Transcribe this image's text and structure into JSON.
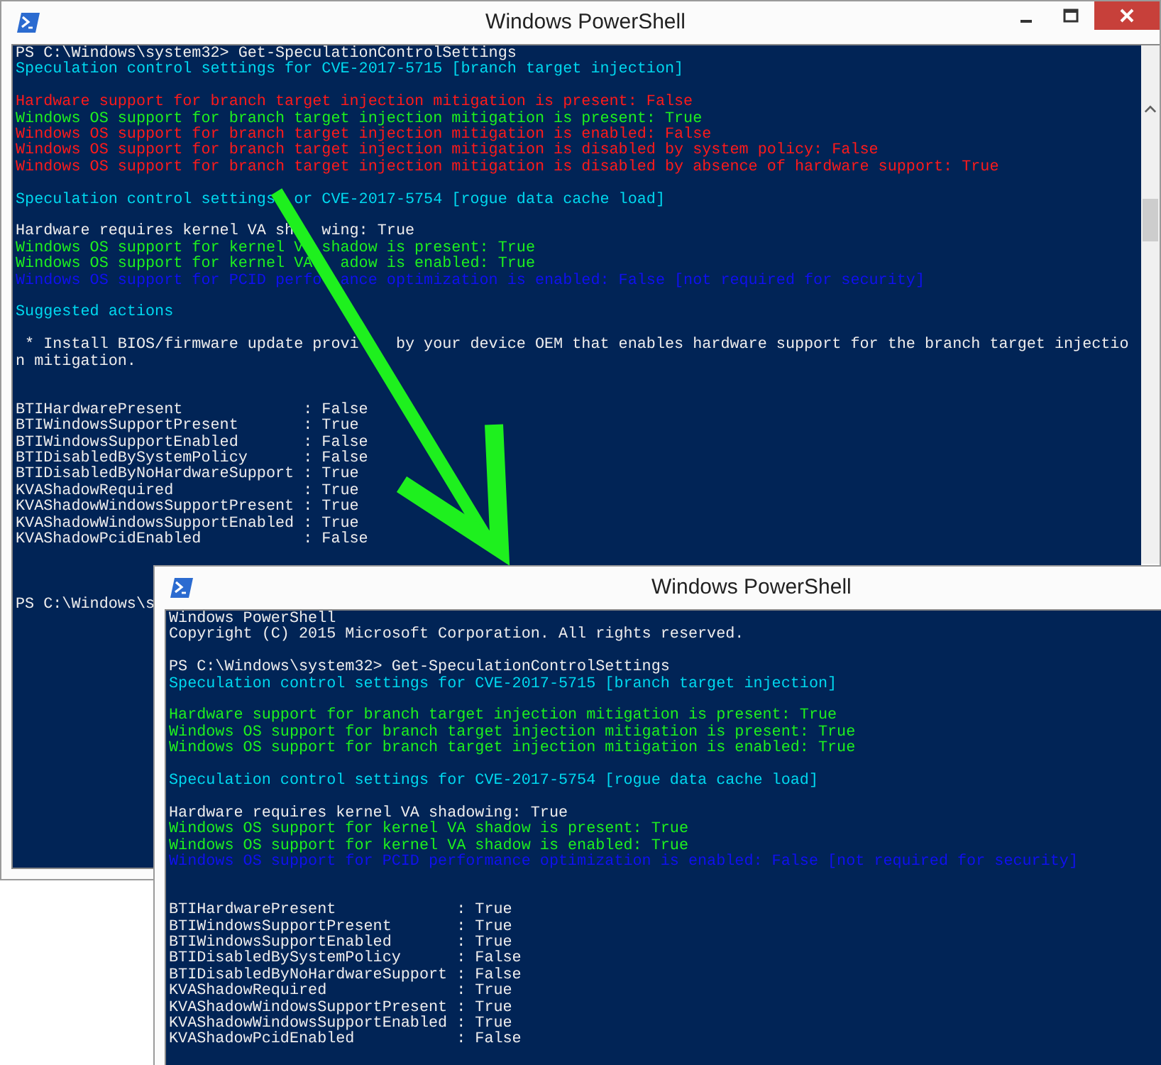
{
  "windows": [
    {
      "title": "Windows PowerShell",
      "controls": true,
      "scrollbar": true,
      "blocks": [
        {
          "kind": "text",
          "lines": [
            {
              "text": "PS C:\\Windows\\system32> Get-SpeculationControlSettings",
              "kind": "plain"
            },
            {
              "text": "Speculation control settings for CVE-2017-5715 [branch target injection]",
              "kind": "heading"
            }
          ]
        },
        {
          "kind": "text",
          "lines": [
            {
              "text": "Hardware support for branch target injection mitigation is present: False",
              "kind": "bad"
            },
            {
              "text": "Windows OS support for branch target injection mitigation is present: True",
              "kind": "good"
            },
            {
              "text": "Windows OS support for branch target injection mitigation is enabled: False",
              "kind": "bad"
            },
            {
              "text": "Windows OS support for branch target injection mitigation is disabled by system policy: False",
              "kind": "bad"
            },
            {
              "text": "Windows OS support for branch target injection mitigation is disabled by absence of hardware support: True",
              "kind": "bad"
            }
          ]
        },
        {
          "kind": "text",
          "lines": [
            {
              "text": "Speculation control settings  or CVE-2017-5754 [rogue data cache load]",
              "kind": "heading"
            }
          ]
        },
        {
          "kind": "text",
          "lines": [
            {
              "text": "Hardware requires kernel VA sh   wing: True",
              "kind": "plain"
            },
            {
              "text": "Windows OS support for kernel V  shadow is present: True",
              "kind": "good"
            },
            {
              "text": "Windows OS support for kernel VA   adow is enabled: True",
              "kind": "good"
            },
            {
              "text": "Windows OS support for PCID perfo  ance optimization is enabled: False [not required for security]",
              "kind": "info"
            }
          ]
        },
        {
          "kind": "text",
          "lines": [
            {
              "text": "Suggested actions",
              "kind": "heading"
            }
          ]
        },
        {
          "kind": "text",
          "lines": [
            {
              "text": " * Install BIOS/firmware update provi    by your device OEM that enables hardware support for the branch target injectio",
              "kind": "plain"
            },
            {
              "text": "n mitigation.",
              "kind": "plain"
            }
          ]
        },
        {
          "kind": "table",
          "lines": [
            {
              "text": "BTIHardwarePresent             : False",
              "kind": "plain"
            },
            {
              "text": "BTIWindowsSupportPresent       : True",
              "kind": "plain"
            },
            {
              "text": "BTIWindowsSupportEnabled       : False",
              "kind": "plain"
            },
            {
              "text": "BTIDisabledBySystemPolicy      : False",
              "kind": "plain"
            },
            {
              "text": "BTIDisabledByNoHardwareSupport : True",
              "kind": "plain"
            },
            {
              "text": "KVAShadowRequired              : True",
              "kind": "plain"
            },
            {
              "text": "KVAShadowWindowsSupportPresent : True",
              "kind": "plain"
            },
            {
              "text": "KVAShadowWindowsSupportEnabled : True",
              "kind": "plain"
            },
            {
              "text": "KVAShadowPcidEnabled           : False",
              "kind": "plain"
            }
          ]
        },
        {
          "kind": "prompt",
          "lines": [
            {
              "text": "PS C:\\Windows\\s",
              "kind": "plain"
            }
          ]
        }
      ]
    },
    {
      "title": "Windows PowerShell",
      "blocks": [
        {
          "kind": "text",
          "lines": [
            {
              "text": "Windows PowerShell",
              "kind": "plain"
            },
            {
              "text": "Copyright (C) 2015 Microsoft Corporation. All rights reserved.",
              "kind": "plain"
            }
          ]
        },
        {
          "kind": "text",
          "lines": [
            {
              "text": "PS C:\\Windows\\system32> Get-SpeculationControlSettings",
              "kind": "plain"
            },
            {
              "text": "Speculation control settings for CVE-2017-5715 [branch target injection]",
              "kind": "heading"
            }
          ]
        },
        {
          "kind": "text",
          "lines": [
            {
              "text": "Hardware support for branch target injection mitigation is present: True",
              "kind": "good"
            },
            {
              "text": "Windows OS support for branch target injection mitigation is present: True",
              "kind": "good"
            },
            {
              "text": "Windows OS support for branch target injection mitigation is enabled: True",
              "kind": "good"
            }
          ]
        },
        {
          "kind": "text",
          "lines": [
            {
              "text": "Speculation control settings for CVE-2017-5754 [rogue data cache load]",
              "kind": "heading"
            }
          ]
        },
        {
          "kind": "text",
          "lines": [
            {
              "text": "Hardware requires kernel VA shadowing: True",
              "kind": "plain"
            },
            {
              "text": "Windows OS support for kernel VA shadow is present: True",
              "kind": "good"
            },
            {
              "text": "Windows OS support for kernel VA shadow is enabled: True",
              "kind": "good"
            },
            {
              "text": "Windows OS support for PCID performance optimization is enabled: False [not required for security]",
              "kind": "info"
            }
          ]
        },
        {
          "kind": "table",
          "lines": [
            {
              "text": "BTIHardwarePresent             : True",
              "kind": "plain"
            },
            {
              "text": "BTIWindowsSupportPresent       : True",
              "kind": "plain"
            },
            {
              "text": "BTIWindowsSupportEnabled       : True",
              "kind": "plain"
            },
            {
              "text": "BTIDisabledBySystemPolicy      : False",
              "kind": "plain"
            },
            {
              "text": "BTIDisabledByNoHardwareSupport : False",
              "kind": "plain"
            },
            {
              "text": "KVAShadowRequired              : True",
              "kind": "plain"
            },
            {
              "text": "KVAShadowWindowsSupportPresent : True",
              "kind": "plain"
            },
            {
              "text": "KVAShadowWindowsSupportEnabled : True",
              "kind": "plain"
            },
            {
              "text": "KVAShadowPcidEnabled           : False",
              "kind": "plain"
            }
          ]
        }
      ]
    }
  ]
}
